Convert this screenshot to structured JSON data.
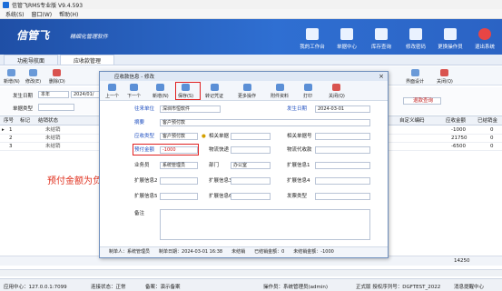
{
  "window": {
    "title": "信管飞RMS专业版 V9.4.593"
  },
  "menu": [
    "系统(S)",
    "窗口(W)",
    "帮助(H)"
  ],
  "brand": {
    "logo": "信管飞",
    "slogan": "精细化管理软件"
  },
  "topnav": [
    "我的工作台",
    "单据中心",
    "库存查询",
    "修改密码",
    "更换操作员",
    "退出系统"
  ],
  "tabs": [
    "功能导航面",
    "应收款管理"
  ],
  "toolbar": [
    "新增(N)",
    "修改(E)",
    "删除(D)",
    "界面设计",
    "关闭(Q)"
  ],
  "filter": {
    "date_label": "发生日期",
    "date_value": "本年",
    "date_from": "2024/01/",
    "type_label": "单据类型",
    "query_btn": "退款查询"
  },
  "grid": {
    "headers": [
      "序号",
      "标记",
      "结销状态",
      "自定义编码",
      "应收金额",
      "已结销金"
    ],
    "rows": [
      {
        "no": "1",
        "status": "未结销",
        "amount": "-1000",
        "mark": "0"
      },
      {
        "no": "2",
        "status": "未结销",
        "amount": "21750",
        "mark": "0"
      },
      {
        "no": "3",
        "status": "未结销",
        "amount": "-6500",
        "mark": "0"
      }
    ],
    "total": "14250"
  },
  "annotation": "预付金额为负",
  "dialog": {
    "title": "应收款信息 - 修改",
    "toolbar": [
      "上一个",
      "下一个",
      "新增(N)",
      "保存(S)",
      "转记凭证",
      "更多操作",
      "附件资料",
      "打印",
      "关闭(Q)"
    ],
    "fields": {
      "company_label": "往来单位",
      "company_value": "深圳市恒软件",
      "date_label": "发生日期",
      "date_value": "2024-03-01",
      "summary_label": "摘要",
      "summary_value": "客户预付款",
      "type_label": "应收类型",
      "type_value": "客户预付款",
      "related_label": "相关单据",
      "related_no_label": "相关单据号",
      "amount_label": "预付金额",
      "amount_value": "-1000",
      "logistics_label": "物流快递",
      "tracking_label": "物流代收款",
      "salesman_label": "业务员",
      "salesman_value": "系统管理员",
      "dept_label": "部门",
      "dept_value": "办公室",
      "ext1": "扩展信息1",
      "ext2": "扩展信息2",
      "ext3": "扩展信息3",
      "ext4": "扩展信息4",
      "ext5": "扩展信息5",
      "ext6": "扩展信息6",
      "invoice_label": "发票类型",
      "note_label": "备注"
    },
    "footer": {
      "creator": "制单人：系统管理员",
      "time": "制单日期：2024-03-01 16:38",
      "status": "未结销",
      "settled": "已结销金额：0",
      "unsettled": "未结销金额：-1000"
    }
  },
  "status": {
    "center": "应用中心：127.0.0.1:7099",
    "conn": "连接状态：正常",
    "info": "备案：演示备案",
    "operator": "操作员：系统管理员(admin)",
    "edition": "正式版 授权序列号：DGFTEST_2022",
    "msg": "消息提醒中心"
  },
  "colors": {
    "header": "#2b63c4",
    "highlight": "#e02020",
    "annotation": "#e0301e"
  }
}
